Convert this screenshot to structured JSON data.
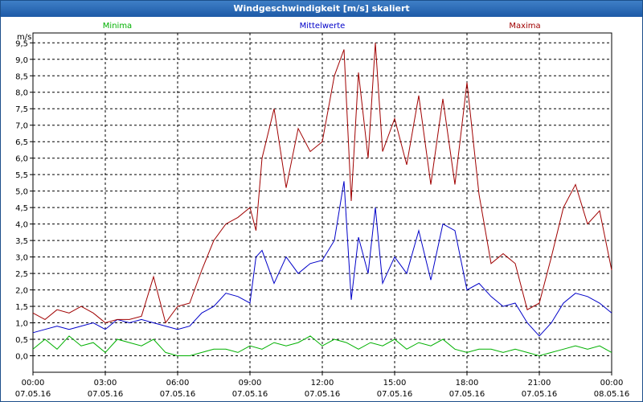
{
  "window": {
    "title": "Windgeschwindigkeit [m/s] skaliert"
  },
  "chart_data": {
    "type": "line",
    "title": "Windgeschwindigkeit [m/s] skaliert",
    "ylabel": "m/s",
    "ylim": [
      -0.5,
      9.8
    ],
    "yticks": [
      "0,0",
      "0,5",
      "1,0",
      "1,5",
      "2,0",
      "2,5",
      "3,0",
      "3,5",
      "4,0",
      "4,5",
      "5,0",
      "5,5",
      "6,0",
      "6,5",
      "7,0",
      "7,5",
      "8,0",
      "8,5",
      "9,0",
      "9,5"
    ],
    "xlim": [
      0,
      24
    ],
    "xticks": [
      {
        "time": "00:00",
        "date": "07.05.16"
      },
      {
        "time": "03:00",
        "date": "07.05.16"
      },
      {
        "time": "06:00",
        "date": "07.05.16"
      },
      {
        "time": "09:00",
        "date": "07.05.16"
      },
      {
        "time": "12:00",
        "date": "07.05.16"
      },
      {
        "time": "15:00",
        "date": "07.05.16"
      },
      {
        "time": "18:00",
        "date": "07.05.16"
      },
      {
        "time": "21:00",
        "date": "07.05.16"
      },
      {
        "time": "00:00",
        "date": "08.05.16"
      }
    ],
    "grid": true,
    "legend_placement": "top",
    "series": [
      {
        "name": "Minima",
        "color": "#00b000",
        "x": [
          0,
          0.5,
          1,
          1.5,
          2,
          2.5,
          3,
          3.5,
          4,
          4.5,
          5,
          5.5,
          6,
          6.5,
          7,
          7.5,
          8,
          8.5,
          9,
          9.5,
          10,
          10.5,
          11,
          11.5,
          12,
          12.5,
          13,
          13.5,
          14,
          14.5,
          15,
          15.5,
          16,
          16.5,
          17,
          17.5,
          18,
          18.5,
          19,
          19.5,
          20,
          20.5,
          21,
          21.5,
          22,
          22.5,
          23,
          23.5,
          24
        ],
        "y": [
          0.2,
          0.5,
          0.2,
          0.6,
          0.3,
          0.4,
          0.1,
          0.5,
          0.4,
          0.3,
          0.5,
          0.1,
          0.0,
          0.0,
          0.1,
          0.2,
          0.2,
          0.1,
          0.3,
          0.2,
          0.4,
          0.3,
          0.4,
          0.6,
          0.3,
          0.5,
          0.4,
          0.2,
          0.4,
          0.3,
          0.5,
          0.2,
          0.4,
          0.3,
          0.5,
          0.2,
          0.1,
          0.2,
          0.2,
          0.1,
          0.2,
          0.1,
          0.0,
          0.1,
          0.2,
          0.3,
          0.2,
          0.3,
          0.1
        ]
      },
      {
        "name": "Mittelwerte",
        "color": "#0000c8",
        "x": [
          0,
          0.5,
          1,
          1.5,
          2,
          2.5,
          3,
          3.5,
          4,
          4.5,
          5,
          5.5,
          6,
          6.5,
          7,
          7.5,
          8,
          8.5,
          9,
          9.25,
          9.5,
          10,
          10.5,
          11,
          11.5,
          12,
          12.5,
          12.9,
          13.2,
          13.5,
          13.9,
          14.2,
          14.5,
          15,
          15.5,
          16,
          16.5,
          17,
          17.5,
          18,
          18.5,
          19,
          19.5,
          20,
          20.5,
          21,
          21.5,
          22,
          22.5,
          23,
          23.5,
          24
        ],
        "y": [
          0.7,
          0.8,
          0.9,
          0.8,
          0.9,
          1.0,
          0.8,
          1.1,
          1.0,
          1.1,
          1.0,
          0.9,
          0.8,
          0.9,
          1.3,
          1.5,
          1.9,
          1.8,
          1.6,
          3.0,
          3.2,
          2.2,
          3.0,
          2.5,
          2.8,
          2.9,
          3.5,
          5.3,
          1.7,
          3.6,
          2.5,
          4.5,
          2.2,
          3.0,
          2.5,
          3.8,
          2.3,
          4.0,
          3.8,
          2.0,
          2.2,
          1.8,
          1.5,
          1.6,
          1.0,
          0.6,
          1.0,
          1.6,
          1.9,
          1.8,
          1.6,
          1.3
        ]
      },
      {
        "name": "Maxima",
        "color": "#a00000",
        "x": [
          0,
          0.5,
          1,
          1.5,
          2,
          2.5,
          3,
          3.5,
          4,
          4.5,
          5,
          5.5,
          6,
          6.5,
          7,
          7.5,
          8,
          8.5,
          9,
          9.25,
          9.5,
          10,
          10.5,
          11,
          11.5,
          12,
          12.5,
          12.9,
          13.2,
          13.5,
          13.9,
          14.2,
          14.5,
          15,
          15.5,
          16,
          16.5,
          17,
          17.5,
          18,
          18.5,
          19,
          19.5,
          20,
          20.5,
          21,
          21.5,
          22,
          22.5,
          23,
          23.5,
          24
        ],
        "y": [
          1.3,
          1.1,
          1.4,
          1.3,
          1.5,
          1.3,
          1.0,
          1.1,
          1.1,
          1.2,
          2.4,
          1.0,
          1.5,
          1.6,
          2.6,
          3.5,
          4.0,
          4.2,
          4.5,
          3.8,
          6.0,
          7.5,
          5.1,
          6.9,
          6.2,
          6.5,
          8.5,
          9.3,
          4.7,
          8.6,
          6.0,
          9.5,
          6.2,
          7.2,
          5.8,
          7.9,
          5.2,
          7.8,
          5.2,
          8.3,
          4.9,
          2.8,
          3.1,
          2.8,
          1.4,
          1.6,
          3.0,
          4.5,
          5.2,
          4.0,
          4.4,
          2.6
        ]
      }
    ]
  }
}
